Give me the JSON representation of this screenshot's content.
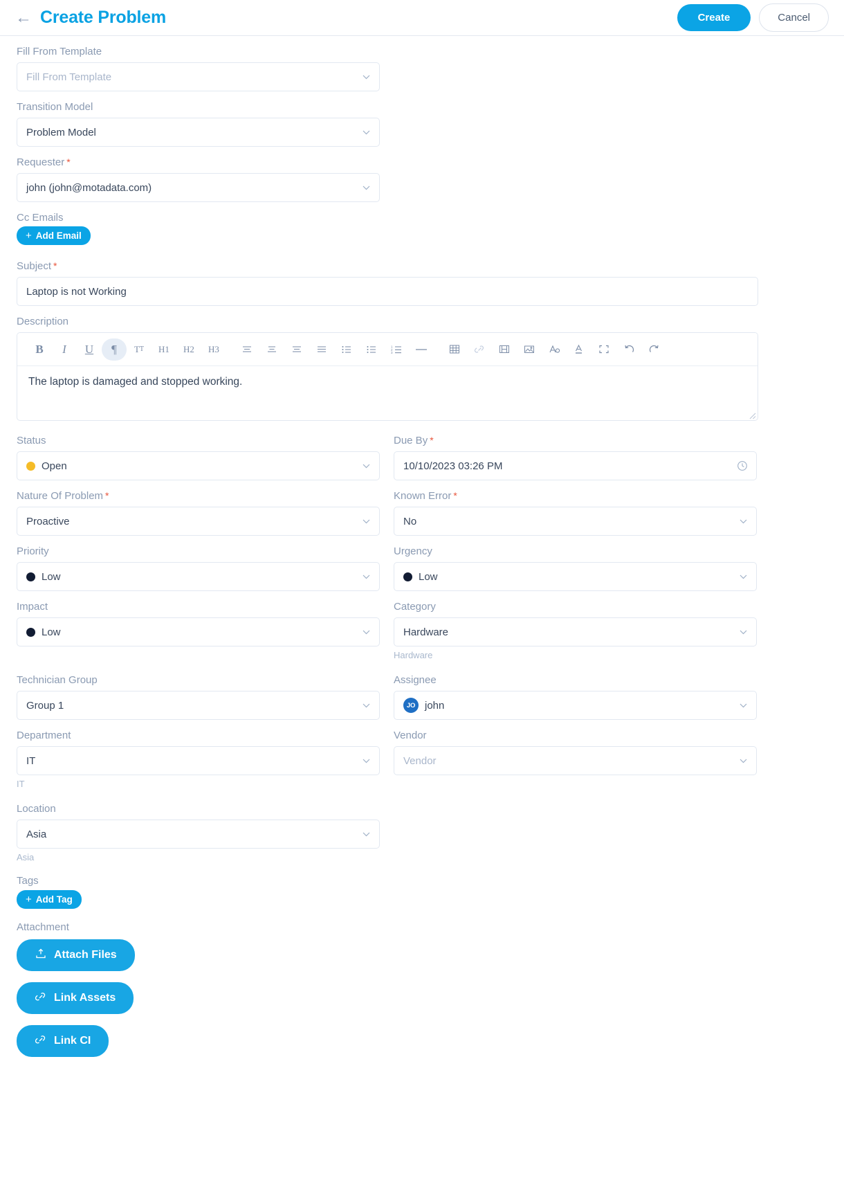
{
  "header": {
    "back_icon": "arrow-left-icon",
    "title": "Create Problem",
    "create_label": "Create",
    "cancel_label": "Cancel"
  },
  "colors": {
    "accent": "#0ba4e5",
    "title": "#0aa2e3",
    "label": "#8a9ab2",
    "required": "#e8553c",
    "status_open_dot": "#f5bc28",
    "priority_dot": "#121c33",
    "avatar_bg": "#1f6fc4"
  },
  "fields": {
    "fill_from_template": {
      "label": "Fill From Template",
      "value": "",
      "placeholder": "Fill From Template"
    },
    "transition_model": {
      "label": "Transition Model",
      "value": "Problem Model"
    },
    "requester": {
      "label": "Requester",
      "required": true,
      "value": "john (john@motadata.com)"
    },
    "cc_emails": {
      "label": "Cc Emails",
      "add_label": "Add Email"
    },
    "subject": {
      "label": "Subject",
      "required": true,
      "value": "Laptop is not Working"
    },
    "description": {
      "label": "Description",
      "value": "The laptop is damaged and stopped working."
    },
    "status": {
      "label": "Status",
      "value": "Open",
      "dot_color": "#f5bc28"
    },
    "due_by": {
      "label": "Due By",
      "required": true,
      "value": "10/10/2023 03:26 PM"
    },
    "nature_of_problem": {
      "label": "Nature Of Problem",
      "required": true,
      "value": "Proactive"
    },
    "known_error": {
      "label": "Known Error",
      "required": true,
      "value": "No"
    },
    "priority": {
      "label": "Priority",
      "value": "Low",
      "dot_color": "#121c33"
    },
    "urgency": {
      "label": "Urgency",
      "value": "Low",
      "dot_color": "#121c33"
    },
    "impact": {
      "label": "Impact",
      "value": "Low",
      "dot_color": "#121c33"
    },
    "category": {
      "label": "Category",
      "value": "Hardware",
      "hint": "Hardware"
    },
    "technician_group": {
      "label": "Technician Group",
      "value": "Group 1"
    },
    "assignee": {
      "label": "Assignee",
      "value": "john",
      "avatar_initials": "JO"
    },
    "department": {
      "label": "Department",
      "value": "IT",
      "hint": "IT"
    },
    "vendor": {
      "label": "Vendor",
      "value": "",
      "placeholder": "Vendor"
    },
    "location": {
      "label": "Location",
      "value": "Asia",
      "hint": "Asia"
    },
    "tags": {
      "label": "Tags",
      "add_label": "Add Tag"
    },
    "attachment": {
      "label": "Attachment",
      "attach_files_label": "Attach Files",
      "link_assets_label": "Link Assets",
      "link_ci_label": "Link CI"
    }
  },
  "editor_toolbar": [
    {
      "name": "bold-icon",
      "glyph": "B",
      "style": "bold",
      "active": false
    },
    {
      "name": "italic-icon",
      "glyph": "I",
      "style": "italic",
      "active": false
    },
    {
      "name": "underline-icon",
      "glyph": "U",
      "style": "underline",
      "active": false
    },
    {
      "name": "paragraph-icon",
      "glyph": "¶",
      "style": "plain",
      "active": true
    },
    {
      "name": "clear-format-icon",
      "glyph": "Tт",
      "style": "small",
      "active": false
    },
    {
      "name": "heading-1-icon",
      "glyph": "H1",
      "style": "small",
      "active": false
    },
    {
      "name": "heading-2-icon",
      "glyph": "H2",
      "style": "small",
      "active": false
    },
    {
      "name": "heading-3-icon",
      "glyph": "H3",
      "style": "small",
      "active": false
    },
    {
      "name": "align-left-icon",
      "glyph": "",
      "style": "svg",
      "active": false
    },
    {
      "name": "align-center-icon",
      "glyph": "",
      "style": "svg",
      "active": false
    },
    {
      "name": "align-right-icon",
      "glyph": "",
      "style": "svg",
      "active": false
    },
    {
      "name": "align-justify-icon",
      "glyph": "",
      "style": "svg",
      "active": false
    },
    {
      "name": "bullet-list-icon",
      "glyph": "",
      "style": "svg",
      "active": false
    },
    {
      "name": "bullet-list-alt-icon",
      "glyph": "",
      "style": "svg",
      "active": false
    },
    {
      "name": "numbered-list-icon",
      "glyph": "",
      "style": "svg",
      "active": false
    },
    {
      "name": "horizontal-rule-icon",
      "glyph": "",
      "style": "svg",
      "active": false
    },
    {
      "name": "table-icon",
      "glyph": "",
      "style": "svg",
      "active": false
    },
    {
      "name": "link-icon",
      "glyph": "",
      "style": "svg",
      "active": false
    },
    {
      "name": "video-icon",
      "glyph": "",
      "style": "svg",
      "active": false
    },
    {
      "name": "image-icon",
      "glyph": "",
      "style": "svg",
      "active": false
    },
    {
      "name": "font-color-icon",
      "glyph": "",
      "style": "svg",
      "active": false
    },
    {
      "name": "text-color-icon",
      "glyph": "",
      "style": "svg",
      "active": false
    },
    {
      "name": "fullscreen-icon",
      "glyph": "",
      "style": "svg",
      "active": false
    },
    {
      "name": "undo-icon",
      "glyph": "",
      "style": "svg",
      "active": false
    },
    {
      "name": "redo-icon",
      "glyph": "",
      "style": "svg",
      "active": false
    }
  ]
}
